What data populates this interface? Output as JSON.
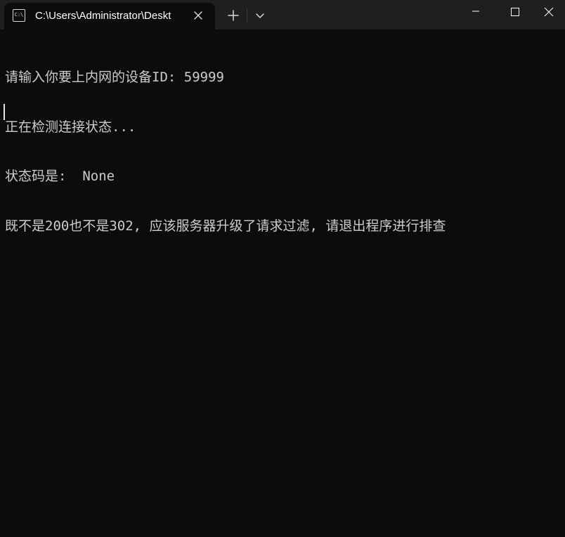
{
  "window": {
    "tab_title": "C:\\Users\\Administrator\\Deskt",
    "tab_icon": "C:\\",
    "icons": {
      "tab": "terminal-icon",
      "close_tab": "close-icon",
      "new_tab": "plus-icon",
      "dropdown": "chevron-down-icon",
      "minimize": "minimize-icon",
      "maximize": "maximize-icon",
      "close": "close-icon"
    }
  },
  "console": {
    "lines": [
      "请输入你要上内网的设备ID: 59999",
      "正在检测连接状态...",
      "状态码是:  None",
      "既不是200也不是302, 应该服务器升级了请求过滤, 请退出程序进行排查"
    ]
  },
  "colors": {
    "background": "#0c0c0c",
    "titlebar": "#1f1f1f",
    "text": "#cccccc"
  }
}
